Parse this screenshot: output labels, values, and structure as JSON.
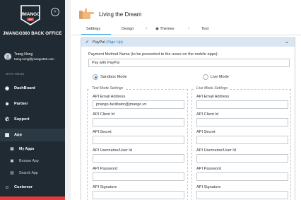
{
  "sidebar": {
    "logo_text": "JMANGO",
    "logo_sub": "360",
    "brand_title": "JMANGO360 BACK OFFICE",
    "user": {
      "name": "Trang Nong",
      "email": "trang.nong@jmango360.com"
    },
    "menu_heading": "MAIN MENU",
    "items": [
      {
        "label": "DashBoard",
        "icon": "dashboard-icon"
      },
      {
        "label": "Partner",
        "icon": "partner-icon"
      },
      {
        "label": "Support",
        "icon": "support-icon"
      },
      {
        "label": "App",
        "icon": "app-icon"
      },
      {
        "label": "Customer",
        "icon": "customer-icon"
      }
    ],
    "app_subitems": [
      {
        "label": "My Apps",
        "icon": "my-apps-icon"
      },
      {
        "label": "Browse App",
        "icon": "browse-app-icon"
      },
      {
        "label": "Search App",
        "icon": "search-app-icon"
      }
    ]
  },
  "header": {
    "title": "Living the Dream"
  },
  "tabs": [
    "Settings",
    "Design",
    "Themes",
    "Test"
  ],
  "panel": {
    "title": "PayPal",
    "signup": "(Sign Up)",
    "payment_method_label": "Payment Method Name (to be presented to the users on the mobile apps):",
    "payment_method_value": "Pay with PayPal",
    "sandbox_label": "Sandbox Mode",
    "live_label": "Live Mode",
    "sandbox_checked": true,
    "test_legend": "Test Mode Settings",
    "live_legend": "Live Mode Settings",
    "test_fields": [
      {
        "label": "API Email Address",
        "value": "jmango-facilitator@jmango.vn"
      },
      {
        "label": "API Client Id",
        "value": ""
      },
      {
        "label": "API Secret",
        "value": ""
      },
      {
        "label": "API Username/User Id",
        "value": ""
      },
      {
        "label": "API Password",
        "value": ""
      },
      {
        "label": "API Signature",
        "value": ""
      }
    ],
    "live_fields": [
      {
        "label": "API Email Address",
        "value": ""
      },
      {
        "label": "API Client Id",
        "value": ""
      },
      {
        "label": "API Secret",
        "value": ""
      },
      {
        "label": "API Username/User Id",
        "value": ""
      },
      {
        "label": "API Password",
        "value": ""
      },
      {
        "label": "API Signature",
        "value": ""
      }
    ]
  },
  "colors": {
    "sidebar_bg": "#1f2a33",
    "accent": "#29a5e3",
    "panel_head": "#d9e6f1",
    "link": "#2a7fc7",
    "alert": "#e23b3b"
  }
}
